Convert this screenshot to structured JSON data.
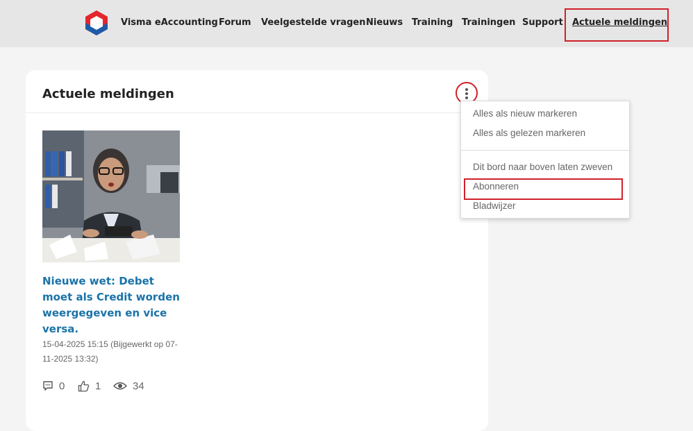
{
  "nav": {
    "items": [
      {
        "label": "Visma eAccounting"
      },
      {
        "label": "Forum"
      },
      {
        "label": "Veelgestelde vragen"
      },
      {
        "label": "Nieuws"
      },
      {
        "label": "Training"
      },
      {
        "label": "Trainingen"
      },
      {
        "label": "Support"
      },
      {
        "label": "Actuele meldingen"
      }
    ],
    "active_index": 7
  },
  "board": {
    "title": "Actuele meldingen"
  },
  "post": {
    "title": "Nieuwe wet: Debet moet als Credit worden weergegeven en vice versa.",
    "date": "15-04-2025 15:15 (Bijgewerkt op 07-11-2025 13:32)",
    "stats": {
      "comments": "0",
      "likes": "1",
      "views": "34"
    }
  },
  "menu": {
    "items": [
      {
        "label": "Alles als nieuw markeren"
      },
      {
        "label": "Alles als gelezen markeren"
      },
      {
        "label": "Dit bord naar boven laten zweven"
      },
      {
        "label": "Abonneren"
      },
      {
        "label": "Bladwijzer"
      }
    ]
  },
  "colors": {
    "accent_link": "#1a73a8",
    "highlight_red": "#d0202a",
    "logo_red": "#e3262d",
    "logo_blue": "#1e5aa8"
  },
  "icons": {
    "comments": "speech-bubble-icon",
    "likes": "thumbs-up-icon",
    "views": "eye-icon",
    "menu": "vertical-dots-icon"
  }
}
